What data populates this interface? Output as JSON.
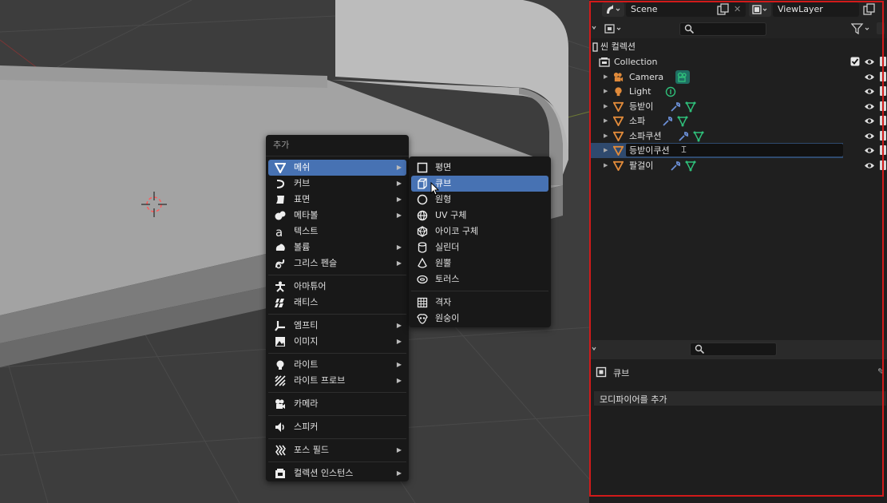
{
  "add_menu": {
    "title": "추가",
    "items": [
      {
        "label": "메쉬",
        "icon": "mesh-icon",
        "submenu": true,
        "active": true
      },
      {
        "label": "커브",
        "icon": "curve-icon",
        "submenu": true
      },
      {
        "label": "표면",
        "icon": "surface-icon",
        "submenu": true
      },
      {
        "label": "메타볼",
        "icon": "metaball-icon",
        "submenu": true
      },
      {
        "label": "텍스트",
        "icon": "text-icon",
        "submenu": false
      },
      {
        "label": "볼륨",
        "icon": "volume-icon",
        "submenu": true
      },
      {
        "label": "그리스 펜슬",
        "icon": "grease-pencil-icon",
        "submenu": true
      },
      {
        "label": "아마튜어",
        "icon": "armature-icon",
        "submenu": false
      },
      {
        "label": "래티스",
        "icon": "lattice-icon",
        "submenu": false
      },
      {
        "label": "엠프티",
        "icon": "empty-icon",
        "submenu": true
      },
      {
        "label": "이미지",
        "icon": "image-icon",
        "submenu": true
      },
      {
        "label": "라이트",
        "icon": "light-icon",
        "submenu": true
      },
      {
        "label": "라이트 프로브",
        "icon": "light-probe-icon",
        "submenu": true
      },
      {
        "label": "카메라",
        "icon": "camera-icon",
        "submenu": false
      },
      {
        "label": "스피커",
        "icon": "speaker-icon",
        "submenu": false
      },
      {
        "label": "포스 필드",
        "icon": "force-field-icon",
        "submenu": true
      },
      {
        "label": "컬렉션 인스턴스",
        "icon": "collection-instance-icon",
        "submenu": true
      }
    ],
    "arrow": "▶"
  },
  "mesh_menu": {
    "items": [
      {
        "label": "평면",
        "icon": "plane-icon"
      },
      {
        "label": "큐브",
        "icon": "cube-icon",
        "active": true
      },
      {
        "label": "원형",
        "icon": "circle-icon"
      },
      {
        "label": "UV 구체",
        "icon": "uv-sphere-icon"
      },
      {
        "label": "아이코 구체",
        "icon": "ico-sphere-icon"
      },
      {
        "label": "실린더",
        "icon": "cylinder-icon"
      },
      {
        "label": "원뿔",
        "icon": "cone-icon"
      },
      {
        "label": "토러스",
        "icon": "torus-icon"
      },
      {
        "label": "격자",
        "icon": "grid-icon"
      },
      {
        "label": "원숭이",
        "icon": "monkey-icon"
      }
    ]
  },
  "topbar": {
    "scene": "Scene",
    "view_layer": "ViewLayer"
  },
  "outliner": {
    "root": "씬 컬렉션",
    "collection": "Collection",
    "rows": [
      {
        "name": "Camera",
        "type": "camera"
      },
      {
        "name": "Light",
        "type": "light"
      },
      {
        "name": "등받이",
        "type": "mesh"
      },
      {
        "name": "소파",
        "type": "mesh"
      },
      {
        "name": "소파쿠션",
        "type": "mesh"
      },
      {
        "name": "등받이쿠션",
        "type": "mesh",
        "selected": true,
        "editing": true
      },
      {
        "name": "팔걸이",
        "type": "mesh"
      }
    ]
  },
  "properties": {
    "object_name": "큐브",
    "add_modifier": "모디파이어를 추가"
  },
  "colors": {
    "accent": "#4772b3",
    "frame": "#d11a1a",
    "mesh_orange": "#e08a3a",
    "data_green": "#2fbf7a",
    "wrench_blue": "#6b8fd6"
  }
}
